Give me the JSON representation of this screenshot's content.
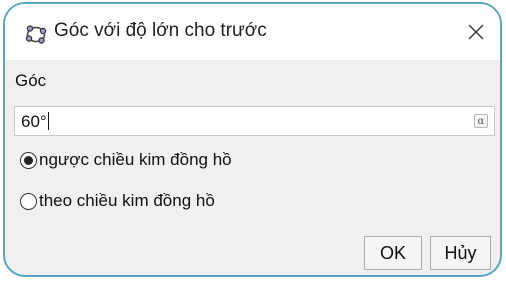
{
  "window": {
    "title": "Góc với độ lớn cho trước",
    "app_icon": "geogebra-icon",
    "close_icon": "close-icon"
  },
  "angle_section": {
    "label": "Góc",
    "input_value": "60°",
    "alpha_button": "α"
  },
  "direction": {
    "options": [
      {
        "label": "ngược chiều kim đồng hồ",
        "selected": true
      },
      {
        "label": "theo chiều kim đồng hồ",
        "selected": false
      }
    ]
  },
  "buttons": {
    "ok": "OK",
    "cancel": "Hủy"
  },
  "colors": {
    "border_accent": "#5aa6c2",
    "dialog_bg": "#f0f0f0"
  }
}
